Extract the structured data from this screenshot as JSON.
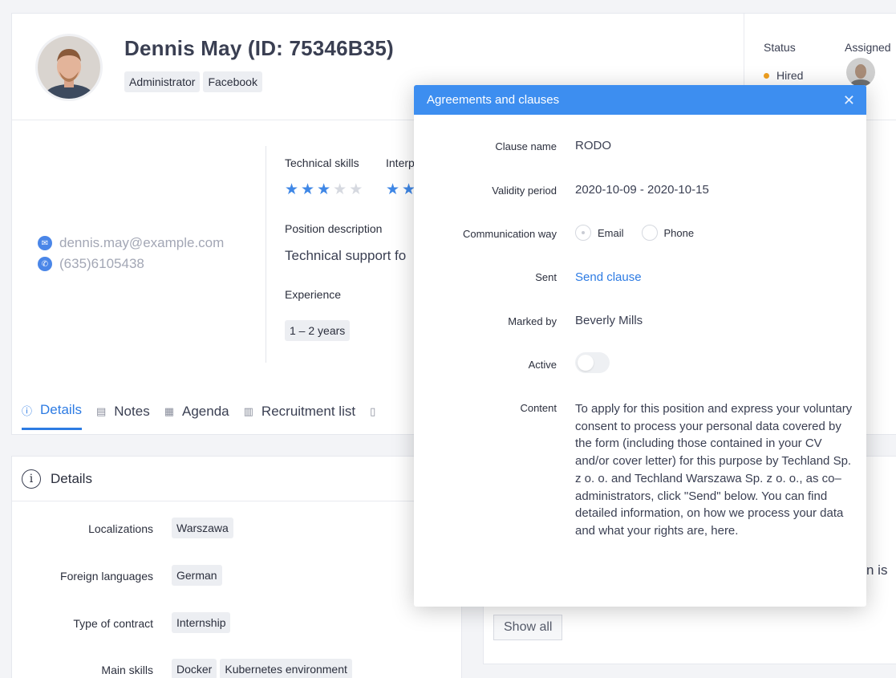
{
  "profile": {
    "name": "Dennis May (ID: 75346B35)",
    "tags": [
      "Administrator",
      "Facebook"
    ],
    "status_label": "Status",
    "status_value": "Hired",
    "assigned_label": "Assigned",
    "email": "dennis.may@example.com",
    "phone": "(635)6105438",
    "technical_skills_label": "Technical skills",
    "technical_skills_rating": 3,
    "technical_skills_max": 5,
    "interpersonal_label": "Interp",
    "position_description_label": "Position description",
    "position_description": "Technical support fo",
    "experience_label": "Experience",
    "experience_value": "1 – 2 years"
  },
  "tabs": [
    {
      "label": "Details",
      "icon": "info-icon"
    },
    {
      "label": "Notes",
      "icon": "document-icon"
    },
    {
      "label": "Agenda",
      "icon": "calendar-icon"
    },
    {
      "label": "Recruitment list",
      "icon": "clipboard-icon"
    }
  ],
  "details": {
    "title": "Details",
    "rows": [
      {
        "label": "Localizations",
        "values": [
          "Warszawa"
        ]
      },
      {
        "label": "Foreign languages",
        "values": [
          "German"
        ]
      },
      {
        "label": "Type of contract",
        "values": [
          "Internship"
        ]
      },
      {
        "label": "Main skills",
        "values": [
          "Docker",
          "Kubernetes environment"
        ]
      }
    ]
  },
  "right_card": {
    "partial_text": "n is",
    "show_all_label": "Show all"
  },
  "modal": {
    "title": "Agreements and clauses",
    "clause_name_label": "Clause name",
    "clause_name": "RODO",
    "validity_label": "Validity period",
    "validity_value": "2020-10-09 - 2020-10-15",
    "communication_label": "Communication way",
    "communication_options": [
      "Email",
      "Phone"
    ],
    "sent_label": "Sent",
    "sent_link": "Send clause",
    "marked_by_label": "Marked by",
    "marked_by": "Beverly Mills",
    "active_label": "Active",
    "content_label": "Content",
    "content": "To apply for this position and express your voluntary consent to process your personal data covered by the form (including those contained in your CV and/or cover letter) for this purpose by Techland Sp. z o. o. and Techland Warszawa Sp. z o. o., as co–administrators, click \"Send\" below. You can find detailed information, on how we process your data and what your rights are, here."
  },
  "colors": {
    "accent": "#3d8ef0",
    "status_dot": "#f0a020",
    "link": "#2d7be3"
  }
}
